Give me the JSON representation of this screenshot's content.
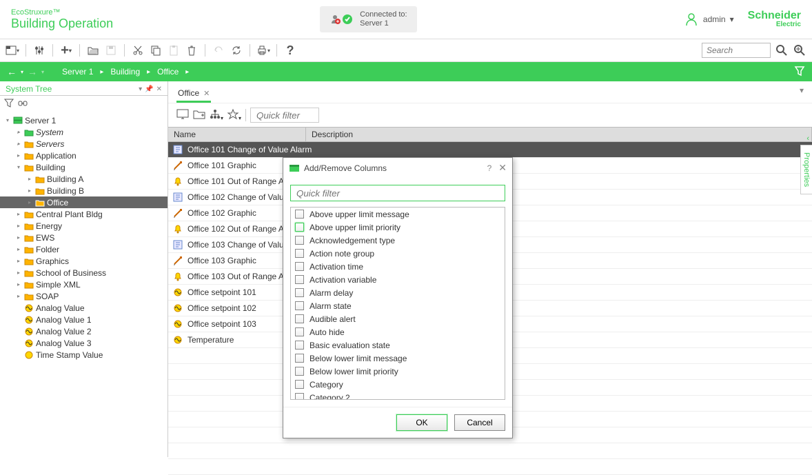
{
  "brand": {
    "top": "EcoStruxure™",
    "bottom_bold": "Building",
    "bottom_thin": " Operation",
    "company": "Schneider Electric"
  },
  "connection": {
    "label": "Connected to:",
    "server": "Server 1"
  },
  "user": {
    "name": "admin"
  },
  "search_placeholder": "Search",
  "breadcrumb": [
    "Server 1",
    "Building",
    "Office"
  ],
  "panels": {
    "tree_title": "System Tree",
    "properties": "Properties"
  },
  "tree": [
    {
      "d": 0,
      "exp": "down",
      "ico": "server",
      "label": "Server 1"
    },
    {
      "d": 1,
      "exp": "right",
      "ico": "sys",
      "label": "System",
      "italic": true
    },
    {
      "d": 1,
      "exp": "right",
      "ico": "folder",
      "label": "Servers",
      "italic": true
    },
    {
      "d": 1,
      "exp": "right",
      "ico": "folder",
      "label": "Application"
    },
    {
      "d": 1,
      "exp": "down",
      "ico": "folder",
      "label": "Building"
    },
    {
      "d": 2,
      "exp": "right",
      "ico": "folder",
      "label": "Building A"
    },
    {
      "d": 2,
      "exp": "right",
      "ico": "folder",
      "label": "Building B"
    },
    {
      "d": 2,
      "exp": "right",
      "ico": "folder",
      "label": "Office",
      "selected": true
    },
    {
      "d": 1,
      "exp": "right",
      "ico": "folder",
      "label": "Central Plant Bldg"
    },
    {
      "d": 1,
      "exp": "right",
      "ico": "folder",
      "label": "Energy"
    },
    {
      "d": 1,
      "exp": "right",
      "ico": "folder",
      "label": "EWS"
    },
    {
      "d": 1,
      "exp": "right",
      "ico": "folder",
      "label": "Folder"
    },
    {
      "d": 1,
      "exp": "right",
      "ico": "folder",
      "label": "Graphics"
    },
    {
      "d": 1,
      "exp": "right",
      "ico": "folder",
      "label": "School of Business"
    },
    {
      "d": 1,
      "exp": "right",
      "ico": "folder",
      "label": "Simple XML"
    },
    {
      "d": 1,
      "exp": "right",
      "ico": "folder",
      "label": "SOAP"
    },
    {
      "d": 1,
      "exp": "none",
      "ico": "analog",
      "label": "Analog Value"
    },
    {
      "d": 1,
      "exp": "none",
      "ico": "analog",
      "label": "Analog Value 1"
    },
    {
      "d": 1,
      "exp": "none",
      "ico": "analog",
      "label": "Analog Value 2"
    },
    {
      "d": 1,
      "exp": "none",
      "ico": "analog",
      "label": "Analog Value 3"
    },
    {
      "d": 1,
      "exp": "none",
      "ico": "dot",
      "label": "Time Stamp Value"
    }
  ],
  "tab": {
    "label": "Office"
  },
  "quick_filter": "Quick filter",
  "grid": {
    "columns": {
      "name": "Name",
      "description": "Description"
    },
    "rows": [
      {
        "ico": "cov",
        "label": "Office 101 Change of Value Alarm",
        "selected": true
      },
      {
        "ico": "graphic",
        "label": "Office 101 Graphic"
      },
      {
        "ico": "bell",
        "label": "Office 101 Out of Range Alarm"
      },
      {
        "ico": "cov",
        "label": "Office 102 Change of Value Alarm"
      },
      {
        "ico": "graphic",
        "label": "Office 102 Graphic"
      },
      {
        "ico": "bell",
        "label": "Office 102 Out of Range Alarm"
      },
      {
        "ico": "cov",
        "label": "Office 103 Change of Value Alarm"
      },
      {
        "ico": "graphic",
        "label": "Office 103 Graphic"
      },
      {
        "ico": "bell",
        "label": "Office 103 Out of Range Alarm"
      },
      {
        "ico": "analog",
        "label": "Office setpoint 101"
      },
      {
        "ico": "analog",
        "label": "Office setpoint 102"
      },
      {
        "ico": "analog",
        "label": "Office setpoint 103"
      },
      {
        "ico": "analog",
        "label": "Temperature"
      }
    ]
  },
  "dialog": {
    "title": "Add/Remove Columns",
    "quick_filter": "Quick filter",
    "items": [
      "Above upper limit message",
      "Above upper limit priority",
      "Acknowledgement type",
      "Action note group",
      "Activation time",
      "Activation variable",
      "Alarm delay",
      "Alarm state",
      "Audible alert",
      "Auto hide",
      "Basic evaluation state",
      "Below lower limit message",
      "Below lower limit priority",
      "Category",
      "Category 2"
    ],
    "ok": "OK",
    "cancel": "Cancel"
  }
}
